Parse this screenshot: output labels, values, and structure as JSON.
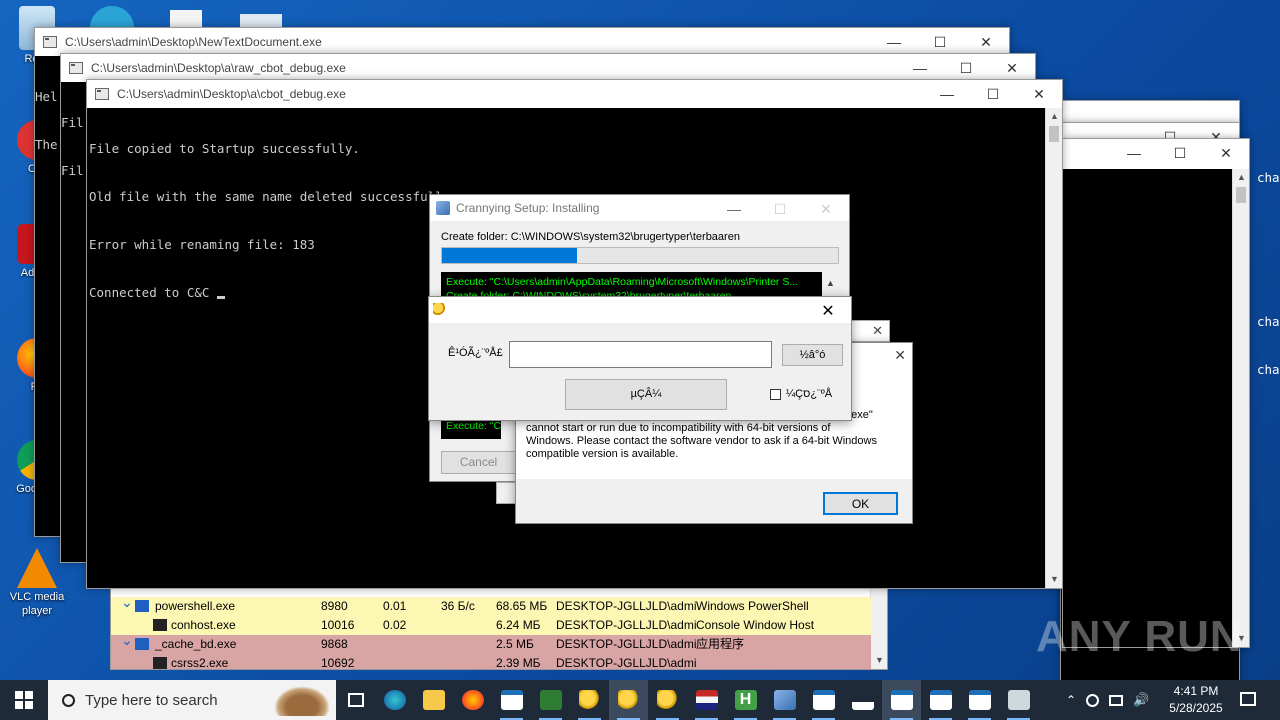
{
  "desktop_icons": [
    {
      "label": "Recy",
      "name": "recycle-bin-icon"
    },
    {
      "label": "CCl",
      "name": "ccleaner-icon"
    },
    {
      "label": "Ad Acr",
      "name": "acrobat-icon"
    },
    {
      "label": "Fir",
      "name": "firefox-icon"
    },
    {
      "label": "Goo Chr",
      "name": "chrome-icon"
    },
    {
      "label": "VLC media player",
      "name": "vlc-icon"
    },
    {
      "label": "charg",
      "name": "charg-icon"
    }
  ],
  "win1": {
    "title": "C:\\Users\\admin\\Desktop\\NewTextDocument.exe",
    "lines": [
      "Hel",
      "The"
    ]
  },
  "win2": {
    "title": "C:\\Users\\admin\\Desktop\\a\\raw_cbot_debug.exe",
    "lines": [
      "Fil",
      "Fil"
    ]
  },
  "win3": {
    "title": "C:\\Users\\admin\\Desktop\\a\\cbot_debug.exe",
    "lines": [
      "File copied to Startup successfully.",
      "Old file with the same name deleted successfully.",
      "Error while renaming file: 183",
      "Connected to C&C "
    ]
  },
  "right_console": {
    "lines": [
      "cha",
      "cha",
      "cha"
    ]
  },
  "installer": {
    "title": "Crannying Setup: Installing",
    "status": "Create folder: C:\\WINDOWS\\system32\\brugertyper\\terbaaren",
    "progress": 0.34,
    "log": [
      "Execute: \"C:\\Users\\admin\\AppData\\Roaming\\Microsoft\\Windows\\Printer S...",
      "Create folder: C:\\WINDOWS\\system32\\brugertyper\\terbaaren"
    ],
    "log_tail": "Execute: \"C:\\",
    "cancel": "Cancel"
  },
  "login_dialog": {
    "label": "Ê¹ÓÃ¿¨ºÅ£",
    "input_value": "",
    "query_button": "½â°ó",
    "login_button": "µÇÂ¼",
    "checkbox_label": "¼Çס¿¨ºÅ"
  },
  "error_dialog": {
    "message_partial": "2.exe\"",
    "message": "cannot start or run due to incompatibility with 64-bit versions of Windows. Please contact the software vendor to ask if a 64-bit Windows compatible version is available.",
    "ok": "OK"
  },
  "process_table": {
    "rows": [
      {
        "indent": 1,
        "name": "powershell.exe",
        "pid": "8980",
        "cpu": "0.01",
        "io": "36 Б/с",
        "mem": "68.65 МБ",
        "user": "DESKTOP-JGLLJLD\\admi",
        "desc": "Windows PowerShell",
        "color": "#fdf7b4"
      },
      {
        "indent": 2,
        "name": "conhost.exe",
        "pid": "10016",
        "cpu": "0.02",
        "io": "",
        "mem": "6.24 МБ",
        "user": "DESKTOP-JGLLJLD\\admi",
        "desc": "Console Window Host",
        "color": "#fdf7b4"
      },
      {
        "indent": 1,
        "name": "_cache_bd.exe",
        "pid": "9868",
        "cpu": "",
        "io": "",
        "mem": "2.5 МБ",
        "user": "DESKTOP-JGLLJLD\\admi",
        "desc": "应用程序",
        "color": "#d9a4a4"
      },
      {
        "indent": 2,
        "name": "csrss2.exe",
        "pid": "10692",
        "cpu": "",
        "io": "",
        "mem": "2.39 МБ",
        "user": "DESKTOP-JGLLJLD\\admi",
        "desc": "",
        "color": "#d9a4a4"
      }
    ]
  },
  "watermark": "ANY RUN",
  "taskbar": {
    "search_placeholder": "Type here to search",
    "time": "4:41 PM",
    "date": "5/28/2025",
    "accent": "#0078d7"
  }
}
